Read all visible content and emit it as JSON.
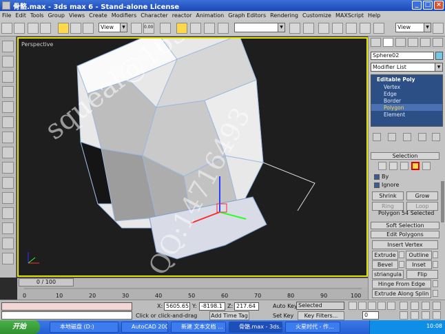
{
  "window": {
    "title": "骨骼.max - 3ds max 6 - Stand-alone License"
  },
  "menu": [
    "File",
    "Edit",
    "Tools",
    "Group",
    "Views",
    "Create",
    "Modifiers",
    "Character",
    "reactor",
    "Animation",
    "Graph Editors",
    "Rendering",
    "Customize",
    "MAXScript",
    "Help"
  ],
  "toolbar": {
    "ref_coord": "View",
    "view_dropdown": "View",
    "named_selection": "",
    "spinner_value": "0.00"
  },
  "viewport": {
    "label": "Perspective",
    "watermark_email": "squeal@163.com",
    "watermark_qq": "QQ:14716493"
  },
  "command_panel": {
    "object_name": "Sphere02",
    "object_color": "#73c8e6",
    "modifier_list_label": "Modifier List",
    "stack_root": "Editable Poly",
    "stack_items": [
      "Vertex",
      "Edge",
      "Border",
      "Polygon",
      "Element"
    ],
    "selected_sub": "Polygon",
    "selection_title": "Selection",
    "by_label": "By",
    "ignore_label": "Ignore",
    "shrink_label": "Shrink",
    "grow_label": "Grow",
    "ring_label": "Ring",
    "loop_label": "Loop",
    "selection_status": "Polygon 54 Selected",
    "soft_selection_title": "Soft Selection",
    "edit_polygons_title": "Edit Polygons",
    "insert_vertex": "Insert Vertex",
    "extrude": "Extrude",
    "outline": "Outline",
    "bevel": "Bevel",
    "inset": "Inset",
    "retriangulate": "striangula",
    "flip": "Flip",
    "hinge_from_edge": "Hinge From Edge",
    "extrude_along_spline": "Extrude Along Splin"
  },
  "timeline": {
    "slider": "0 / 100",
    "ticks": [
      "0",
      "10",
      "20",
      "30",
      "40",
      "50",
      "60",
      "70",
      "80",
      "90",
      "100"
    ]
  },
  "status": {
    "x_label": "X:",
    "x_value": "5605.65",
    "y_label": "Y:",
    "y_value": "-8198.1",
    "z_label": "Z:",
    "z_value": "217.64",
    "prompt": "Click or click-and-drag",
    "add_time_tag": "Add Time Tag",
    "auto_key": "Auto Key",
    "set_key": "Set Key",
    "key_filter_select": "Selected",
    "key_filters": "Key Filters...",
    "frame_value": "0"
  },
  "taskbar": {
    "start": "开始",
    "tasks": [
      "本地磁盘 (D:)",
      "AutoCAD 2004 ...",
      "新建 文本文档 ...",
      "骨骼.max - 3ds...",
      "火星时代 - 作..."
    ],
    "clock": "10:08"
  }
}
